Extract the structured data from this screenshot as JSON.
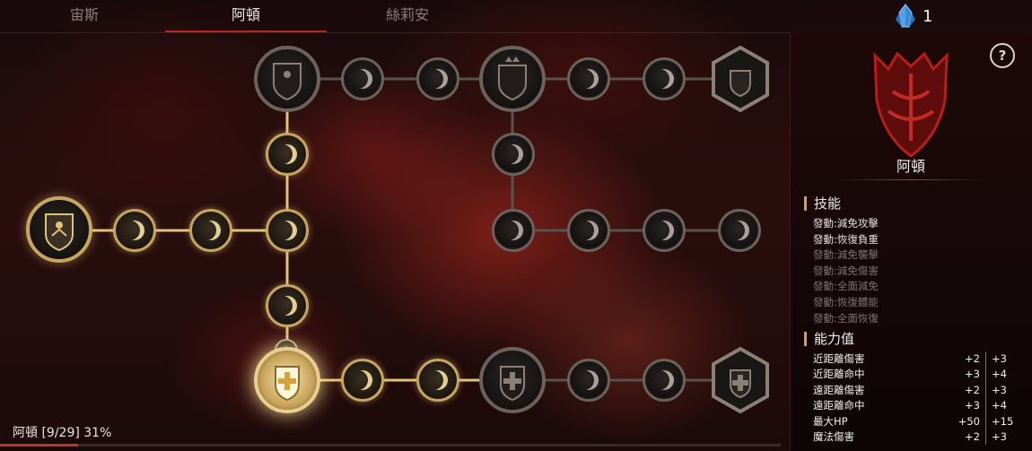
{
  "tabs": [
    {
      "label": "宙斯",
      "active": false
    },
    {
      "label": "阿頓",
      "active": true
    },
    {
      "label": "絲莉安",
      "active": false
    }
  ],
  "currency": {
    "icon": "crystal-icon",
    "value": "1"
  },
  "panel": {
    "help_label": "?",
    "portrait_name": "阿頓",
    "skills_title": "技能",
    "skills": [
      {
        "label": "發動:減免攻擊",
        "unlocked": true
      },
      {
        "label": "發動:恢復負重",
        "unlocked": true
      },
      {
        "label": "發動:減免襲擊",
        "unlocked": false
      },
      {
        "label": "發動:減免傷害",
        "unlocked": false
      },
      {
        "label": "發動:全面減免",
        "unlocked": false
      },
      {
        "label": "發動:恢復體能",
        "unlocked": false
      },
      {
        "label": "發動:全面恢復",
        "unlocked": false
      }
    ],
    "stats_title": "能力值",
    "stats": [
      {
        "name": "近距離傷害",
        "current": "+2",
        "next": "+3"
      },
      {
        "name": "近距離命中",
        "current": "+3",
        "next": "+4"
      },
      {
        "name": "遠距離傷害",
        "current": "+2",
        "next": "+3"
      },
      {
        "name": "遠距離命中",
        "current": "+3",
        "next": "+4"
      },
      {
        "name": "最大HP",
        "current": "+50",
        "next": "+15"
      },
      {
        "name": "魔法傷害",
        "current": "+2",
        "next": "+3"
      }
    ]
  },
  "progress": {
    "label": "阿頓 [9/29] 31%",
    "fraction": 0.31
  },
  "colors": {
    "accent": "#c8322a",
    "gold": "#c9a562",
    "locked": "#6b625b"
  }
}
